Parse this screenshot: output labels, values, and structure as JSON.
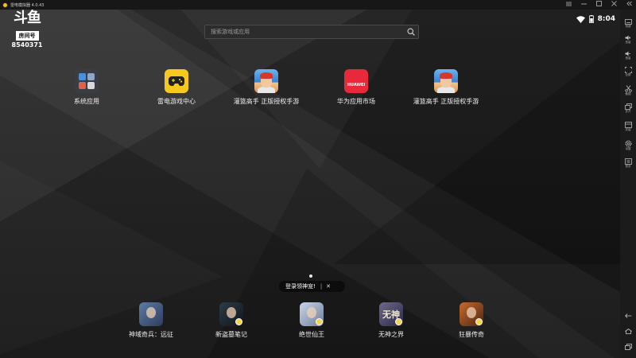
{
  "titlebar": {
    "title": "雷电模拟器 4.0.43",
    "controls": [
      "minimize-icon",
      "restore-icon",
      "close-icon",
      "collapse-icon"
    ]
  },
  "watermark": {
    "logo": "斗鱼",
    "room_label": "房间号",
    "room_id": "8540371"
  },
  "search": {
    "placeholder": "搜索游戏或应用"
  },
  "status": {
    "time": "8:04"
  },
  "apps": [
    {
      "label": "系统应用",
      "icon": "system-apps-icon"
    },
    {
      "label": "雷电游戏中心",
      "icon": "gamepad-icon"
    },
    {
      "label": "灌篮高手 正版授权手游",
      "icon": "slam-dunk-icon"
    },
    {
      "label": "华为应用市场",
      "icon": "huawei-appgallery-icon",
      "icon_text": "HUAWEI"
    },
    {
      "label": "灌篮高手 正版授权手游",
      "icon": "slam-dunk-icon"
    }
  ],
  "dock": [
    {
      "label": "神域奇兵：远征",
      "icon": "shenyu-game-icon"
    },
    {
      "label": "新盗墓笔记",
      "icon": "daomu-game-icon"
    },
    {
      "label": "绝世仙王",
      "icon": "juexian-game-icon"
    },
    {
      "label": "无神之界",
      "icon": "wushen-game-icon",
      "icon_text": "无神"
    },
    {
      "label": "狂暴传奇",
      "icon": "kuangbao-game-icon"
    }
  ],
  "tip": {
    "text": "登录领神宠!",
    "separator": "|",
    "close": "✕"
  },
  "rightbar": {
    "items": [
      {
        "label": "按键"
      },
      {
        "label": "音量"
      },
      {
        "label": "音量"
      },
      {
        "label": "全屏"
      },
      {
        "label": "截图"
      },
      {
        "label": "多开"
      },
      {
        "label": "安装"
      },
      {
        "label": "设置"
      },
      {
        "label": "更多"
      }
    ]
  },
  "colors": {
    "accent_yellow": "#f7c81d",
    "huawei_red": "#e9283a",
    "desktop_dark": "#232323"
  }
}
